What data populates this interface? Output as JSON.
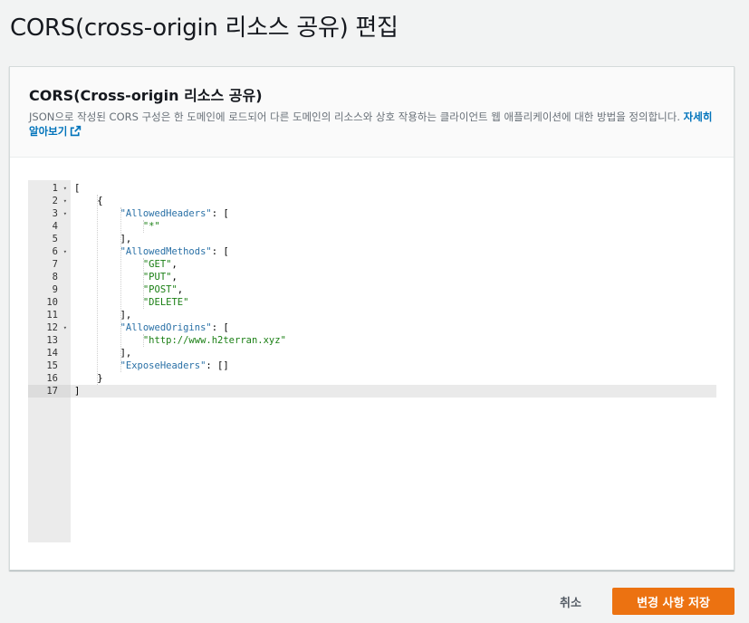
{
  "page": {
    "title": "CORS(cross-origin 리소스 공유) 편집"
  },
  "panel": {
    "title": "CORS(Cross-origin 리소스 공유)",
    "description": "JSON으로 작성된 CORS 구성은 한 도메인에 로드되어 다른 도메인의 리소스와 상호 작용하는 클라이언트 웹 애플리케이션에 대한 방법을 정의합니다.",
    "learn_more": "자세히 알아보기",
    "learn_more_icon": "external-link-icon"
  },
  "editor": {
    "active_line": 17,
    "lines": [
      {
        "num": "1",
        "fold": true,
        "text": "["
      },
      {
        "num": "2",
        "fold": true,
        "text": "    {"
      },
      {
        "num": "3",
        "fold": true,
        "text": "        \"AllowedHeaders\": ["
      },
      {
        "num": "4",
        "fold": false,
        "text": "            \"*\""
      },
      {
        "num": "5",
        "fold": false,
        "text": "        ],"
      },
      {
        "num": "6",
        "fold": true,
        "text": "        \"AllowedMethods\": ["
      },
      {
        "num": "7",
        "fold": false,
        "text": "            \"GET\","
      },
      {
        "num": "8",
        "fold": false,
        "text": "            \"PUT\","
      },
      {
        "num": "9",
        "fold": false,
        "text": "            \"POST\","
      },
      {
        "num": "10",
        "fold": false,
        "text": "            \"DELETE\""
      },
      {
        "num": "11",
        "fold": false,
        "text": "        ],"
      },
      {
        "num": "12",
        "fold": true,
        "text": "        \"AllowedOrigins\": ["
      },
      {
        "num": "13",
        "fold": false,
        "text": "            \"http://www.h2terran.xyz\""
      },
      {
        "num": "14",
        "fold": false,
        "text": "        ],"
      },
      {
        "num": "15",
        "fold": false,
        "text": "        \"ExposeHeaders\": []"
      },
      {
        "num": "16",
        "fold": false,
        "text": "    }"
      },
      {
        "num": "17",
        "fold": false,
        "text": "]"
      }
    ]
  },
  "actions": {
    "cancel_label": "취소",
    "save_label": "변경 사항 저장"
  },
  "colors": {
    "primary_button": "#ec7211",
    "link": "#0073bb",
    "json_key": "#2970a6",
    "json_string": "#1a7f14"
  }
}
